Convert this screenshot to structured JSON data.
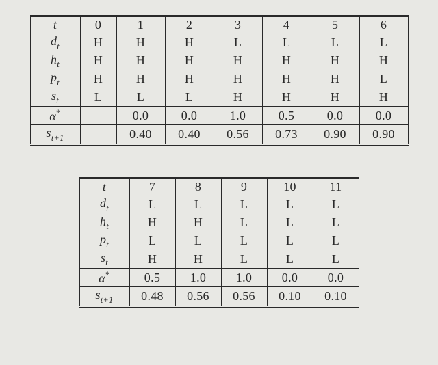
{
  "labels": {
    "t": "t",
    "dt_var": "d",
    "ht_var": "h",
    "pt_var": "p",
    "st_var": "s",
    "sub_t": "t",
    "alpha": "α",
    "star": "*",
    "sbar": "s",
    "sbar_sub": "t+1"
  },
  "table1": {
    "t": [
      "0",
      "1",
      "2",
      "3",
      "4",
      "5",
      "6"
    ],
    "dt": [
      "H",
      "H",
      "H",
      "L",
      "L",
      "L",
      "L"
    ],
    "ht": [
      "H",
      "H",
      "H",
      "H",
      "H",
      "H",
      "H"
    ],
    "pt": [
      "H",
      "H",
      "H",
      "H",
      "H",
      "H",
      "L"
    ],
    "st": [
      "L",
      "L",
      "L",
      "H",
      "H",
      "H",
      "H"
    ],
    "alpha": [
      "",
      "0.0",
      "0.0",
      "1.0",
      "0.5",
      "0.0",
      "0.0"
    ],
    "sbar": [
      "",
      "0.40",
      "0.40",
      "0.56",
      "0.73",
      "0.90",
      "0.90"
    ]
  },
  "table2": {
    "t": [
      "7",
      "8",
      "9",
      "10",
      "11"
    ],
    "dt": [
      "L",
      "L",
      "L",
      "L",
      "L"
    ],
    "ht": [
      "H",
      "H",
      "L",
      "L",
      "L"
    ],
    "pt": [
      "L",
      "L",
      "L",
      "L",
      "L"
    ],
    "st": [
      "H",
      "H",
      "L",
      "L",
      "L"
    ],
    "alpha": [
      "0.5",
      "1.0",
      "1.0",
      "0.0",
      "0.0"
    ],
    "sbar": [
      "0.48",
      "0.56",
      "0.56",
      "0.10",
      "0.10"
    ]
  }
}
